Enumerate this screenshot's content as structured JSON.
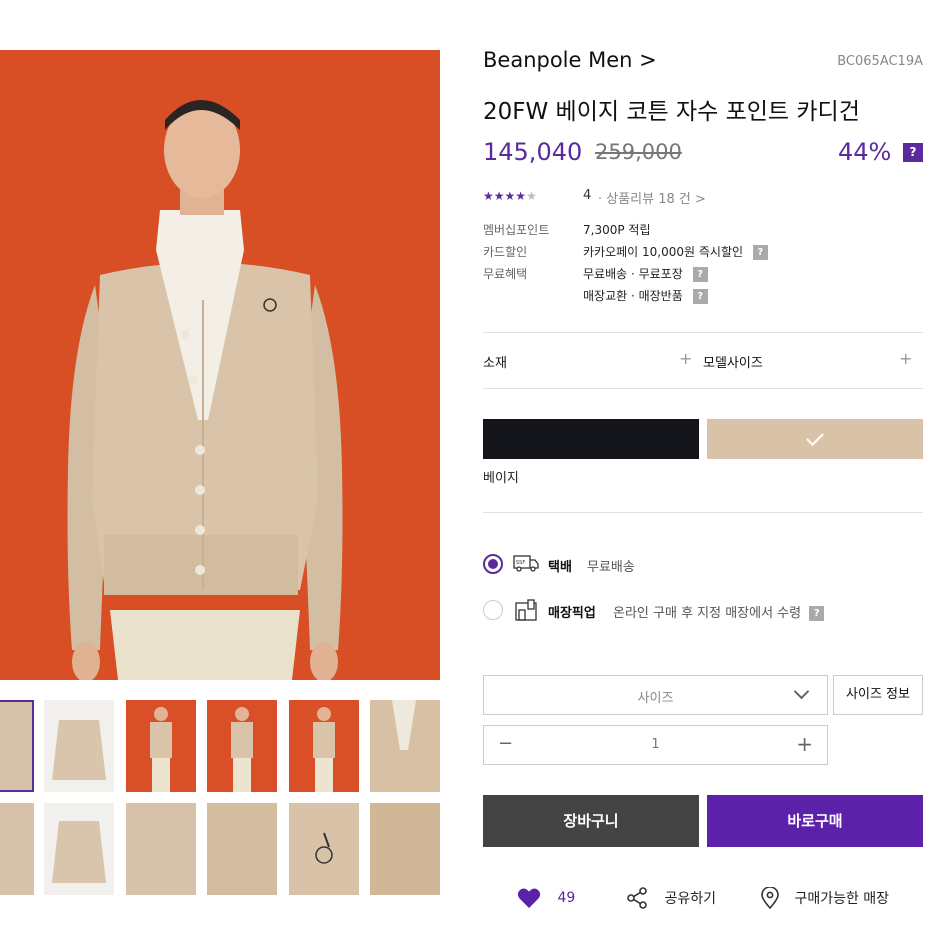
{
  "product": {
    "brand": "Beanpole Men >",
    "code": "BC065AC19A",
    "name": "20FW 베이지 코튼 자수 포인트 카디건",
    "price_sale": "145,040",
    "price_original": "259,000",
    "discount": "44%",
    "discount_help": "?"
  },
  "rating": {
    "stars_filled": 4,
    "stars_total": 5,
    "value": "4",
    "review_link": "· 상품리뷰 18 건 >"
  },
  "benefits": [
    {
      "label": "멤버십포인트",
      "value": "7,300P 적립",
      "help": false
    },
    {
      "label": "카드할인",
      "value": "카카오페이 10,000원 즉시할인",
      "help": true
    },
    {
      "label": "무료혜택",
      "value": "무료배송 · 무료포장",
      "help": true
    },
    {
      "label": "",
      "value": "매장교환 · 매장반품",
      "help": true
    }
  ],
  "accordion": {
    "material_label": "소재",
    "model_size_label": "모델사이즈",
    "plus": "+"
  },
  "colors": {
    "selected_name": "베이지",
    "swatches": [
      {
        "name": "black",
        "hex": "#14151a",
        "selected": false
      },
      {
        "name": "beige",
        "hex": "#d9c3a8",
        "selected": true
      }
    ]
  },
  "shipping": {
    "delivery": {
      "title": "택배",
      "desc": "무료배송",
      "selected": true
    },
    "pickup": {
      "title": "매장픽업",
      "desc": "온라인 구매 후 지정 매장에서 수령",
      "selected": false
    }
  },
  "options": {
    "size_placeholder": "사이즈",
    "size_info_label": "사이즈 정보",
    "quantity": "1",
    "minus": "−",
    "plus": "+"
  },
  "actions": {
    "cart_label": "장바구니",
    "buy_label": "바로구매"
  },
  "footer": {
    "like_count": "49",
    "share_label": "공유하기",
    "store_label": "구매가능한 매장"
  },
  "colors_theme": {
    "accent": "#5b22a9",
    "cart_bg": "#444444",
    "main_bg": "#d84e25"
  }
}
